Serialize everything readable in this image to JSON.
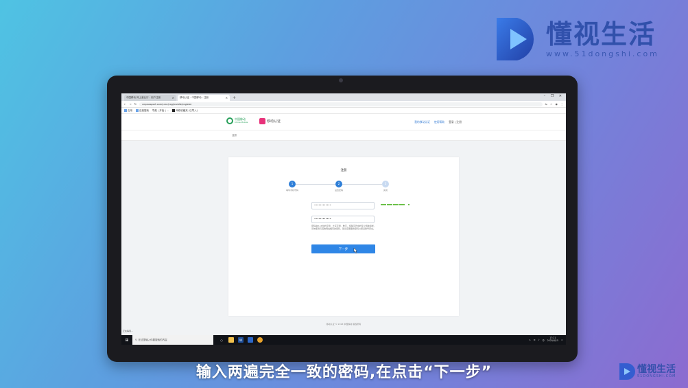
{
  "brand": {
    "name_cn": "懂视生活",
    "domain": "www.51dongshi.com",
    "small_name_cn": "懂视生活",
    "small_domain": "51DONGSHI.COM",
    "color": "#2c4da8"
  },
  "subtitle": "输入两遍完全一致的密码,在点击“下一步”",
  "browser": {
    "tabs": [
      {
        "label": "中国移动 网上营业厅 - 用户注册",
        "active": false
      },
      {
        "label": "移动认证 - 中国移动 - 注册",
        "active": true
      }
    ],
    "new_tab": "+",
    "window_controls": "– ❐ ✕",
    "url": "cmpassport.com/umc/reg/mobile/register",
    "bookmarks": [
      {
        "label": "应用",
        "icon": "apps-icon"
      },
      {
        "label": "百度搜索",
        "icon": "baidu-icon"
      },
      {
        "label": "导航 | 开始 | …",
        "icon": "bookmark-icon"
      },
      {
        "label": "网络收藏夹 (已导入)",
        "icon": "folder-icon"
      }
    ]
  },
  "site": {
    "logo_cn": "中国移动",
    "logo_en": "China Mobile",
    "auth_name": "移动认证",
    "nav": [
      "我的移动认证",
      "使用帮助",
      "登录 | 注册"
    ],
    "breadcrumb": "注册"
  },
  "register": {
    "title": "注册",
    "steps": [
      {
        "num": "1",
        "label": "填写手机号码",
        "state": "done"
      },
      {
        "num": "2",
        "label": "设置密码",
        "state": "current"
      },
      {
        "num": "3",
        "label": "完成",
        "state": "todo"
      }
    ],
    "password_value": "••••••••••••",
    "confirm_value": "••••••••••••",
    "hint": "密码由8-16位的字母、大写字母、数字、特殊字符中的至少两种组成，请勿使用与其他网站相同的密码，建议定期更换密码以保证账号安全。",
    "next_button": "下一步",
    "strength_color": "#6cc04a"
  },
  "page_footer": "移动认证 © 2018 中国移动 版权所有",
  "status_tip": "正在等待…",
  "taskbar": {
    "search_placeholder": "在这里输入你要搜索的内容",
    "ime": "中",
    "clock_time": "17:21",
    "clock_date": "2020/4/15"
  }
}
